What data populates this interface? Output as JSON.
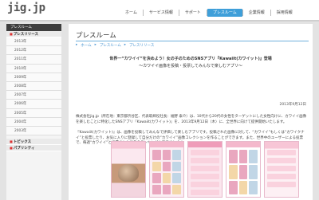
{
  "header": {
    "logo": "jig.jp",
    "nav": [
      {
        "label": "ホーム",
        "active": false
      },
      {
        "label": "サービス情報",
        "active": false
      },
      {
        "label": "サポート",
        "active": false
      },
      {
        "label": "プレスルーム",
        "active": true
      },
      {
        "label": "企業情報",
        "active": false
      },
      {
        "label": "採用情報",
        "active": false
      }
    ]
  },
  "sidebar": {
    "heading": "プレスルーム",
    "press_section": "プレスリリース",
    "years": [
      "2013年",
      "2012年",
      "2011年",
      "2010年",
      "2009年",
      "2008年",
      "2007年",
      "2006年",
      "2005年",
      "2004年",
      "2003年"
    ],
    "topics_section": "トピックス",
    "publicity_section": "パブリシティ"
  },
  "main": {
    "title": "プレスルーム",
    "breadcrumbs": [
      "ホーム",
      "プレスルーム",
      "プレスリリース"
    ],
    "headline1": "世界一“カワイイ”を決めよう！女の子のためのSNSアプリ『Kawaiit(カワイット)』登場",
    "headline2": "～カワイイ画像を投稿・投票してみんなで楽しむアプリ～",
    "date": "2013年9月12日",
    "paragraph1": "株式会社jig.jp（所在地：東京都渋谷区、代表取締役社長：福野 泰介）は、10代から20代の女性をターゲットにした女性向けに、カワイイ画像を楽しむことに特化したSNSアプリ『Kawaiit(カワイット)』を、2013年9月12日（木）に、全世界に向けて提供開始いたします。",
    "paragraph2": "『Kawaiit(カワイット)』は、画像を投稿してみんなで評価して楽しむアプリです。投稿された画像に対して、“カワイイ”もしくは“カワイクナイ”と投票したり、お気に入りに登録して自分だけの“カワイイ”画像コレクションを作ることができます。また、世界中のユーザーによる投票で、毎週“カワイイ”と投票された画像のランキングも発表されます。"
  }
}
